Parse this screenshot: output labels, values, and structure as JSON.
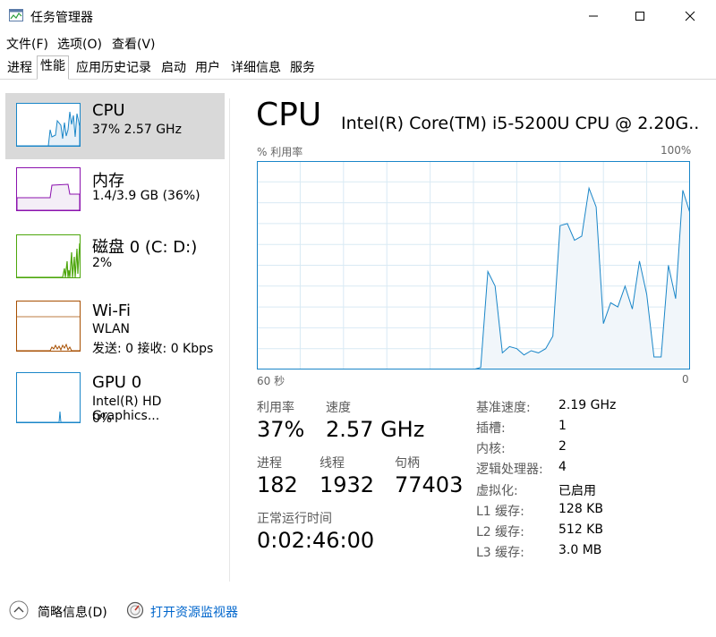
{
  "window": {
    "title": "任务管理器"
  },
  "menu": {
    "file": "文件(F)",
    "options": "选项(O)",
    "view": "查看(V)"
  },
  "tabs": [
    "进程",
    "性能",
    "应用历史记录",
    "启动",
    "用户",
    "详细信息",
    "服务"
  ],
  "sidebar": {
    "items": [
      {
        "title": "CPU",
        "sub1": "37%  2.57 GHz"
      },
      {
        "title": "内存",
        "sub1": "1.4/3.9 GB (36%)"
      },
      {
        "title": "磁盘 0 (C: D:)",
        "sub1": "2%"
      },
      {
        "title": "Wi-Fi",
        "sub1": "WLAN",
        "sub2": "发送: 0  接收: 0 Kbps"
      },
      {
        "title": "GPU 0",
        "sub1": "Intel(R) HD Graphics...",
        "sub2": "0%"
      }
    ]
  },
  "main": {
    "title": "CPU",
    "model": "Intel(R) Core(TM) i5-5200U CPU @ 2.20G...",
    "graph_ylabel": "% 利用率",
    "graph_max": "100%",
    "graph_xleft": "60 秒",
    "graph_xright": "0",
    "utilization_label": "利用率",
    "utilization_value": "37%",
    "speed_label": "速度",
    "speed_value": "2.57 GHz",
    "processes_label": "进程",
    "processes_value": "182",
    "threads_label": "线程",
    "threads_value": "1932",
    "handles_label": "句柄",
    "handles_value": "77403",
    "uptime_label": "正常运行时间",
    "uptime_value": "0:02:46:00",
    "specs": [
      {
        "key": "基准速度:",
        "value": "2.19 GHz"
      },
      {
        "key": "插槽:",
        "value": "1"
      },
      {
        "key": "内核:",
        "value": "2"
      },
      {
        "key": "逻辑处理器:",
        "value": "4"
      },
      {
        "key": "虚拟化:",
        "value": "已启用"
      },
      {
        "key": "L1 缓存:",
        "value": "128 KB"
      },
      {
        "key": "L2 缓存:",
        "value": "512 KB"
      },
      {
        "key": "L3 缓存:",
        "value": "3.0 MB"
      }
    ]
  },
  "footer": {
    "fewer_details": "简略信息(D)",
    "open_monitor": "打开资源监视器"
  },
  "colors": {
    "cpu": "#1a86c8",
    "cpu_fill": "#f1f6fa",
    "memory": "#8b12ae",
    "disk": "#4da60c",
    "wifi": "#a74f01",
    "gpu": "#1a86c8",
    "grid": "#d9eaf4",
    "link": "#0066cc"
  },
  "chart_data": {
    "type": "area",
    "title": "",
    "xlabel": "",
    "ylabel": "% 利用率",
    "xlim": [
      60,
      0
    ],
    "ylim": [
      0,
      100
    ],
    "grid": true,
    "x": [
      60,
      59,
      58,
      57,
      56,
      55,
      54,
      53,
      52,
      51,
      50,
      49,
      48,
      47,
      46,
      45,
      44,
      43,
      42,
      41,
      40,
      39,
      38,
      37,
      36,
      35,
      34,
      33,
      32,
      31,
      30,
      29,
      28,
      27,
      26,
      25,
      24,
      23,
      22,
      21,
      20,
      19,
      18,
      17,
      16,
      15,
      14,
      13,
      12,
      11,
      10,
      9,
      8,
      7,
      6,
      5,
      4,
      3,
      2,
      1,
      0
    ],
    "series": [
      {
        "values": [
          0,
          0,
          0,
          0,
          0,
          0,
          0,
          0,
          0,
          0,
          0,
          0,
          0,
          0,
          0,
          0,
          0,
          0,
          0,
          0,
          0,
          0,
          0,
          0,
          0,
          0,
          0,
          0,
          0,
          0,
          0,
          1,
          47,
          40,
          8,
          11,
          10,
          7,
          9,
          8,
          10,
          16,
          69,
          70,
          62,
          64,
          87,
          78,
          22,
          32,
          30,
          40,
          29,
          52,
          36,
          6,
          6,
          50,
          34,
          86,
          75,
          29
        ]
      }
    ]
  }
}
